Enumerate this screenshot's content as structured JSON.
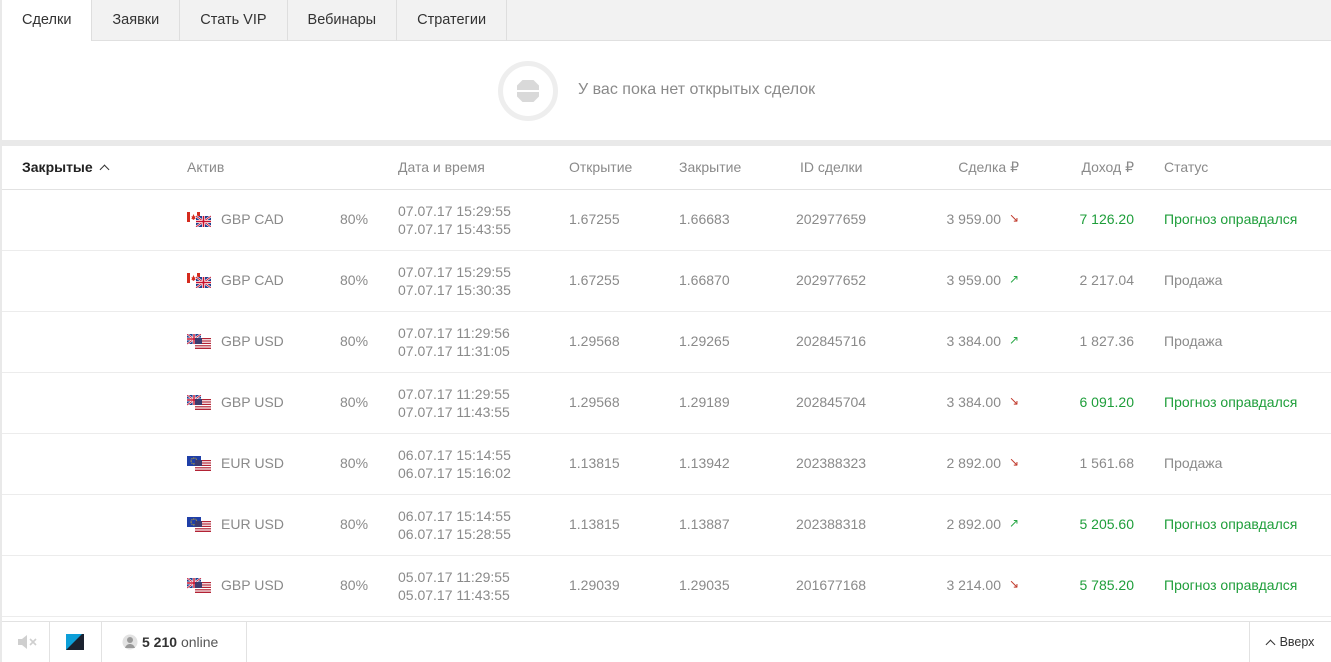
{
  "tabs": [
    {
      "label": "Сделки",
      "active": true
    },
    {
      "label": "Заявки",
      "active": false
    },
    {
      "label": "Стать VIP",
      "active": false
    },
    {
      "label": "Вебинары",
      "active": false
    },
    {
      "label": "Стратегии",
      "active": false
    }
  ],
  "empty_state": {
    "text": "У вас пока нет открытых сделок",
    "icon": "empty-deals-icon"
  },
  "table": {
    "sort_label": "Закрытые",
    "headers": {
      "asset": "Актив",
      "datetime": "Дата и время",
      "open": "Открытие",
      "close": "Закрытие",
      "id": "ID сделки",
      "deal": "Сделка ₽",
      "income": "Доход ₽",
      "status": "Статус"
    },
    "rows": [
      {
        "flag": "gbp-cad-flag-icon",
        "asset": "GBP CAD",
        "pct": "80%",
        "dt1": "07.07.17 15:29:55",
        "dt2": "07.07.17 15:43:55",
        "open": "1.67255",
        "close": "1.66683",
        "id": "202977659",
        "deal": "3 959.00",
        "direction": "down",
        "income": "7 126.20",
        "status": "Прогноз оправдался",
        "win": true
      },
      {
        "flag": "gbp-cad-flag-icon",
        "asset": "GBP CAD",
        "pct": "80%",
        "dt1": "07.07.17 15:29:55",
        "dt2": "07.07.17 15:30:35",
        "open": "1.67255",
        "close": "1.66870",
        "id": "202977652",
        "deal": "3 959.00",
        "direction": "up",
        "income": "2 217.04",
        "status": "Продажа",
        "win": false
      },
      {
        "flag": "gbp-usd-flag-icon",
        "asset": "GBP USD",
        "pct": "80%",
        "dt1": "07.07.17 11:29:56",
        "dt2": "07.07.17 11:31:05",
        "open": "1.29568",
        "close": "1.29265",
        "id": "202845716",
        "deal": "3 384.00",
        "direction": "up",
        "income": "1 827.36",
        "status": "Продажа",
        "win": false
      },
      {
        "flag": "gbp-usd-flag-icon",
        "asset": "GBP USD",
        "pct": "80%",
        "dt1": "07.07.17 11:29:55",
        "dt2": "07.07.17 11:43:55",
        "open": "1.29568",
        "close": "1.29189",
        "id": "202845704",
        "deal": "3 384.00",
        "direction": "down",
        "income": "6 091.20",
        "status": "Прогноз оправдался",
        "win": true
      },
      {
        "flag": "eur-usd-flag-icon",
        "asset": "EUR USD",
        "pct": "80%",
        "dt1": "06.07.17 15:14:55",
        "dt2": "06.07.17 15:16:02",
        "open": "1.13815",
        "close": "1.13942",
        "id": "202388323",
        "deal": "2 892.00",
        "direction": "down",
        "income": "1 561.68",
        "status": "Продажа",
        "win": false
      },
      {
        "flag": "eur-usd-flag-icon",
        "asset": "EUR USD",
        "pct": "80%",
        "dt1": "06.07.17 15:14:55",
        "dt2": "06.07.17 15:28:55",
        "open": "1.13815",
        "close": "1.13887",
        "id": "202388318",
        "deal": "2 892.00",
        "direction": "up",
        "income": "5 205.60",
        "status": "Прогноз оправдался",
        "win": true
      },
      {
        "flag": "gbp-usd-flag-icon",
        "asset": "GBP USD",
        "pct": "80%",
        "dt1": "05.07.17 11:29:55",
        "dt2": "05.07.17 11:43:55",
        "open": "1.29039",
        "close": "1.29035",
        "id": "201677168",
        "deal": "3 214.00",
        "direction": "down",
        "income": "5 785.20",
        "status": "Прогноз оправдался",
        "win": true
      }
    ]
  },
  "footer": {
    "online_count": "5 210",
    "online_label": "online",
    "top_label": "Вверх"
  },
  "colors": {
    "win": "#1e9e3a",
    "down_arrow": "#c0392b",
    "up_arrow": "#27a745"
  }
}
